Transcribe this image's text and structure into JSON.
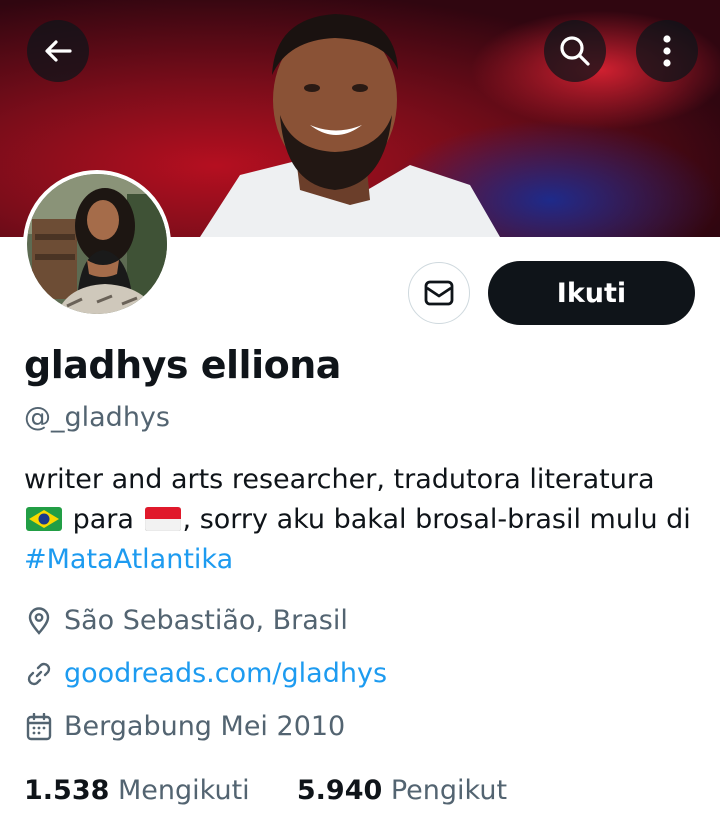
{
  "header": {
    "back_icon": "arrow-left-icon",
    "search_icon": "search-icon",
    "more_icon": "more-vertical-icon"
  },
  "profile": {
    "name": "gladhys elliona",
    "handle": "@_gladhys",
    "follow_label": "Ikuti",
    "message_icon": "envelope-icon",
    "bio": {
      "line1": "writer and arts researcher, tradutora literatura",
      "para": "para",
      "line2_rest": ", sorry aku bakal brosal-brasil mulu di",
      "hashtag": "#MataAtlantika"
    },
    "location": "São Sebastião, Brasil",
    "website": "goodreads.com/gladhys",
    "joined": "Bergabung Mei 2010",
    "following_count": "1.538",
    "following_label": "Mengikuti",
    "followers_count": "5.940",
    "followers_label": "Pengikut"
  },
  "colors": {
    "accent": "#1d9bf0",
    "text": "#0f1419",
    "muted": "#536471"
  }
}
